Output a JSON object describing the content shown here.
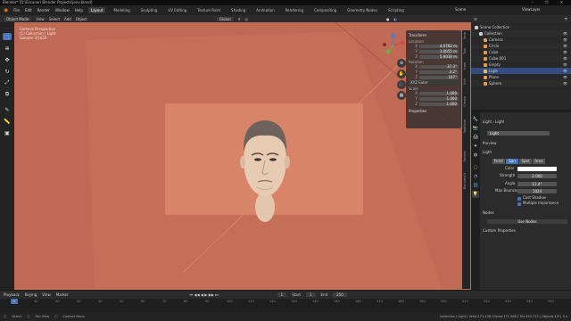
{
  "window": {
    "title": "Blender* [D:\\Escaneri Blender Projects\\jenv.blend]",
    "controls": "– ❐ ✕"
  },
  "menu": {
    "items": [
      "File",
      "Edit",
      "Render",
      "Window",
      "Help"
    ],
    "workspaces": [
      "Layout",
      "Modeling",
      "Sculpting",
      "UV Editing",
      "Texture Paint",
      "Shading",
      "Animation",
      "Rendering",
      "Compositing",
      "Geometry Nodes",
      "Scripting"
    ],
    "active_workspace": "Layout",
    "scene": "Scene",
    "view_layer": "ViewLayer"
  },
  "viewport": {
    "mode": "Object Mode",
    "menus": [
      "View",
      "Select",
      "Add",
      "Object"
    ],
    "orientation": "Global",
    "options": "Options",
    "overlay_lines": [
      "Camera Perspective",
      "(1) Collection | Light",
      "Sample 3/1024"
    ],
    "accent": "#c26b56"
  },
  "npanel": {
    "transform_title": "Transform",
    "location_label": "Location",
    "location": [
      {
        "axis": "X",
        "value": "4.0762 m"
      },
      {
        "axis": "Y",
        "value": "1.0055 m"
      },
      {
        "axis": "Z",
        "value": "5.9039 m"
      }
    ],
    "rotation_label": "Rotation",
    "rotation": [
      {
        "axis": "X",
        "value": "37.3°"
      },
      {
        "axis": "Y",
        "value": "3.2°"
      },
      {
        "axis": "Z",
        "value": "107°"
      }
    ],
    "rotation_mode": "XYZ Euler",
    "scale_label": "Scale",
    "scale": [
      {
        "axis": "X",
        "value": "1.000"
      },
      {
        "axis": "Y",
        "value": "1.000"
      },
      {
        "axis": "Z",
        "value": "1.000"
      }
    ],
    "properties": "Properties",
    "tabs": [
      "Item",
      "Tool",
      "View",
      "Edit",
      "Create",
      "Realtime",
      "Render",
      "BlenderKit"
    ]
  },
  "outliner": {
    "search_placeholder": "",
    "rows": [
      {
        "label": "Scene Collection",
        "indent": 0,
        "icon_color": "#cccccc"
      },
      {
        "label": "Collection",
        "indent": 1,
        "icon_color": "#cccccc"
      },
      {
        "label": "Camera",
        "indent": 2,
        "icon_color": "#d6a35c"
      },
      {
        "label": "Circle",
        "indent": 2,
        "icon_color": "#e89a4a"
      },
      {
        "label": "Cube",
        "indent": 2,
        "icon_color": "#e89a4a"
      },
      {
        "label": "Cube.001",
        "indent": 2,
        "icon_color": "#e89a4a"
      },
      {
        "label": "Empty",
        "indent": 2,
        "icon_color": "#e89a4a"
      },
      {
        "label": "Light",
        "indent": 2,
        "icon_color": "#e0c060",
        "selected": true
      },
      {
        "label": "Plane",
        "indent": 2,
        "icon_color": "#e89a4a"
      },
      {
        "label": "Sphere",
        "indent": 2,
        "icon_color": "#e89a4a"
      }
    ]
  },
  "properties": {
    "breadcrumb": "Light  ›  Light",
    "datablock": "Light",
    "preview": "Preview",
    "light_section": "Light",
    "types": [
      "Point",
      "Sun",
      "Spot",
      "Area"
    ],
    "active_type": "Sun",
    "color_label": "Color",
    "strength_label": "Strength",
    "strength": "2.000",
    "angle_label": "Angle",
    "angle": "11.4°",
    "bounces_label": "Max Bounces",
    "bounces": "1024",
    "cast_shadow": "Cast Shadow",
    "multiple_importance": "Multiple Importance",
    "nodes_section": "Nodes",
    "use_nodes": "Use Nodes",
    "custom_props": "Custom Properties"
  },
  "timeline": {
    "menus": [
      "Playback",
      "Keying",
      "View",
      "Marker"
    ],
    "current_frame": "1",
    "start_label": "Start",
    "start": "1",
    "end_label": "End",
    "end": "250",
    "ticks": [
      "0",
      "10",
      "20",
      "30",
      "40",
      "50",
      "60",
      "70",
      "80",
      "90",
      "100",
      "110",
      "120",
      "130",
      "140",
      "150",
      "160",
      "170",
      "180",
      "190",
      "200",
      "210",
      "220",
      "230",
      "240",
      "250"
    ]
  },
  "status": {
    "items": [
      "Select",
      "Pan View",
      "Context Menu"
    ],
    "right": "Collection | Light | Verts:171,138 | Faces:171,566 | Tris:342,712 | Objects:1/9 | 3.x"
  }
}
